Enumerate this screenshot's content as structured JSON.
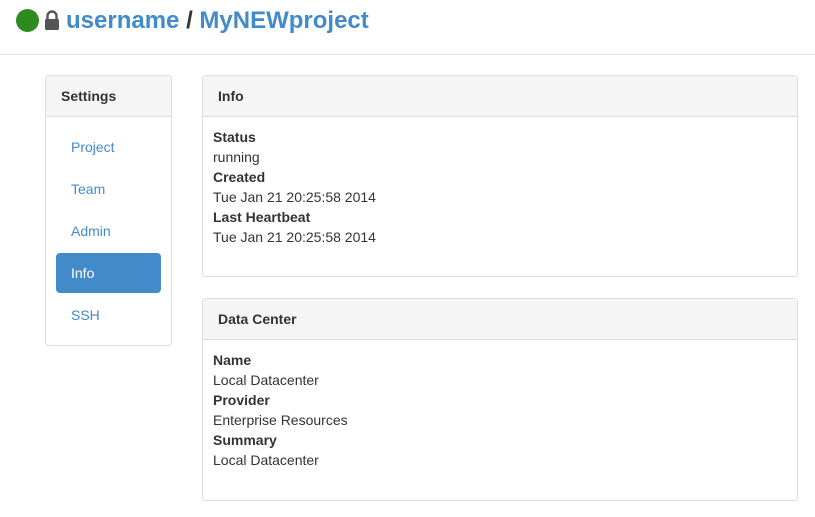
{
  "header": {
    "owner": "username",
    "separator": "/",
    "project": "MyNEWproject",
    "status_color": "#2e8b1e",
    "lock_icon": "lock-icon"
  },
  "sidebar": {
    "title": "Settings",
    "items": [
      {
        "label": "Project",
        "active": false
      },
      {
        "label": "Team",
        "active": false
      },
      {
        "label": "Admin",
        "active": false
      },
      {
        "label": "Info",
        "active": true
      },
      {
        "label": "SSH",
        "active": false
      }
    ]
  },
  "info": {
    "title": "Info",
    "fields": [
      {
        "label": "Status",
        "value": "running"
      },
      {
        "label": "Created",
        "value": "Tue Jan 21 20:25:58 2014"
      },
      {
        "label": "Last Heartbeat",
        "value": "Tue Jan 21 20:25:58 2014"
      }
    ]
  },
  "datacenter": {
    "title": "Data Center",
    "fields": [
      {
        "label": "Name",
        "value": "Local Datacenter"
      },
      {
        "label": "Provider",
        "value": "Enterprise Resources"
      },
      {
        "label": "Summary",
        "value": "Local Datacenter"
      }
    ]
  },
  "colors": {
    "accent": "#428bca",
    "panel_heading_bg": "#f5f5f5",
    "border": "#dddddd"
  }
}
